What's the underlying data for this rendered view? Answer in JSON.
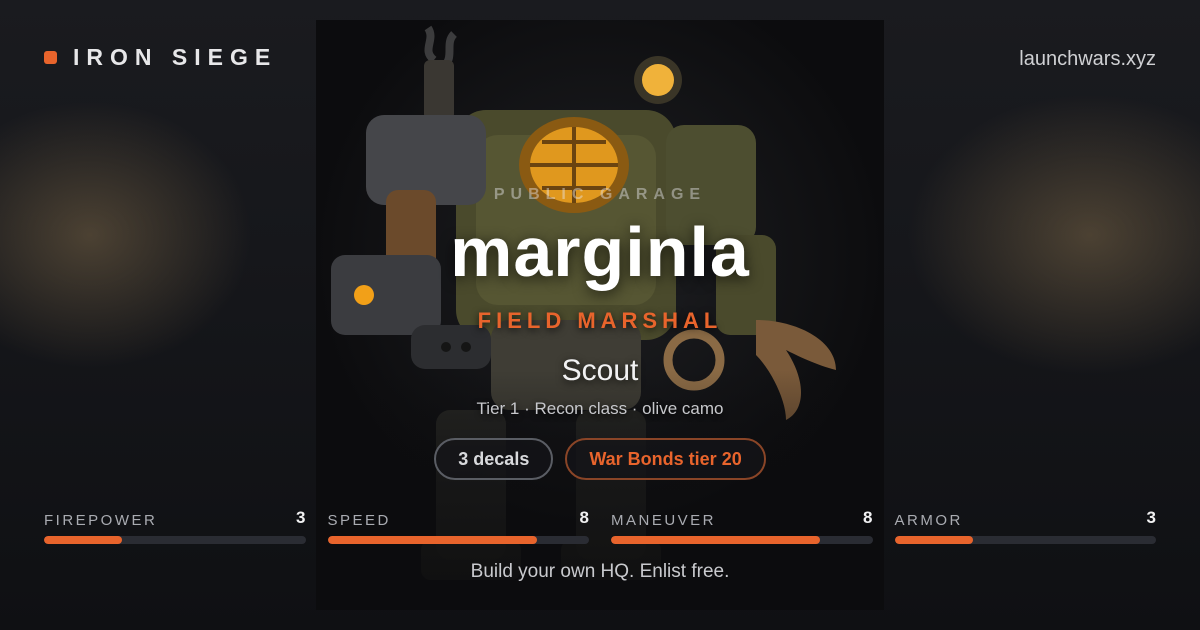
{
  "brand": {
    "name": "IRON SIEGE",
    "accent": "#e8642c"
  },
  "site": "launchwars.xyz",
  "profile": {
    "kicker": "PUBLIC GARAGE",
    "username": "marginla",
    "rank": "FIELD MARSHAL",
    "mech_class": "Scout",
    "details": "Tier 1 · Recon class · olive camo",
    "mech_image": "steampunk-mech-robot"
  },
  "badges": {
    "decals": "3 decals",
    "war_bonds": "War Bonds tier 20"
  },
  "stats": [
    {
      "label": "FIREPOWER",
      "value": 3,
      "fraction": 0.3
    },
    {
      "label": "SPEED",
      "value": 8,
      "fraction": 0.8
    },
    {
      "label": "MANEUVER",
      "value": 8,
      "fraction": 0.8
    },
    {
      "label": "ARMOR",
      "value": 3,
      "fraction": 0.3
    }
  ],
  "footer": "Build your own HQ. Enlist free."
}
